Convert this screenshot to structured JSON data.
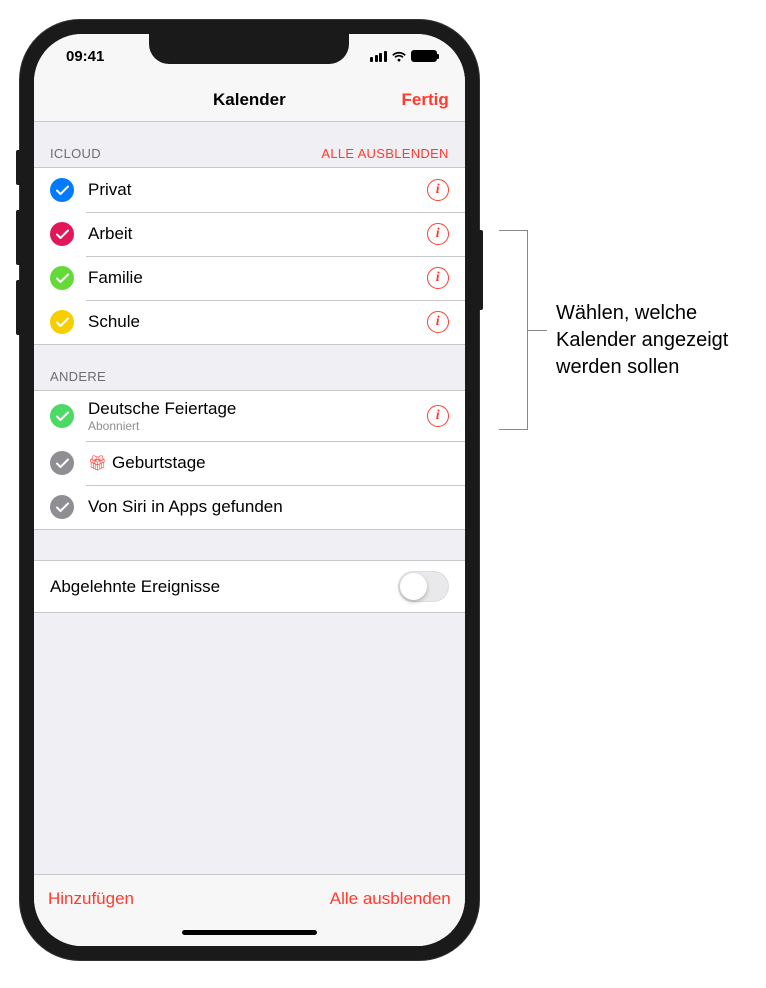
{
  "status": {
    "time": "09:41"
  },
  "nav": {
    "title": "Kalender",
    "done": "Fertig"
  },
  "sections": {
    "icloud": {
      "header": "ICLOUD",
      "action": "ALLE AUSBLENDEN",
      "items": [
        {
          "label": "Privat",
          "color": "#007aff"
        },
        {
          "label": "Arbeit",
          "color": "#e2175a"
        },
        {
          "label": "Familie",
          "color": "#63da38"
        },
        {
          "label": "Schule",
          "color": "#f7ce00"
        }
      ]
    },
    "other": {
      "header": "ANDERE",
      "items": [
        {
          "label": "Deutsche Feiertage",
          "sublabel": "Abonniert",
          "color": "#4cd964",
          "info": true
        },
        {
          "label": "Geburtstage",
          "color": "#8e8e93",
          "gift": true
        },
        {
          "label": "Von Siri in Apps gefunden",
          "color": "#8e8e93"
        }
      ]
    }
  },
  "declined": {
    "label": "Abgelehnte Ereignisse"
  },
  "toolbar": {
    "add": "Hinzufügen",
    "hideAll": "Alle ausblenden"
  },
  "callout": "Wählen, welche Kalender angezeigt werden sollen"
}
